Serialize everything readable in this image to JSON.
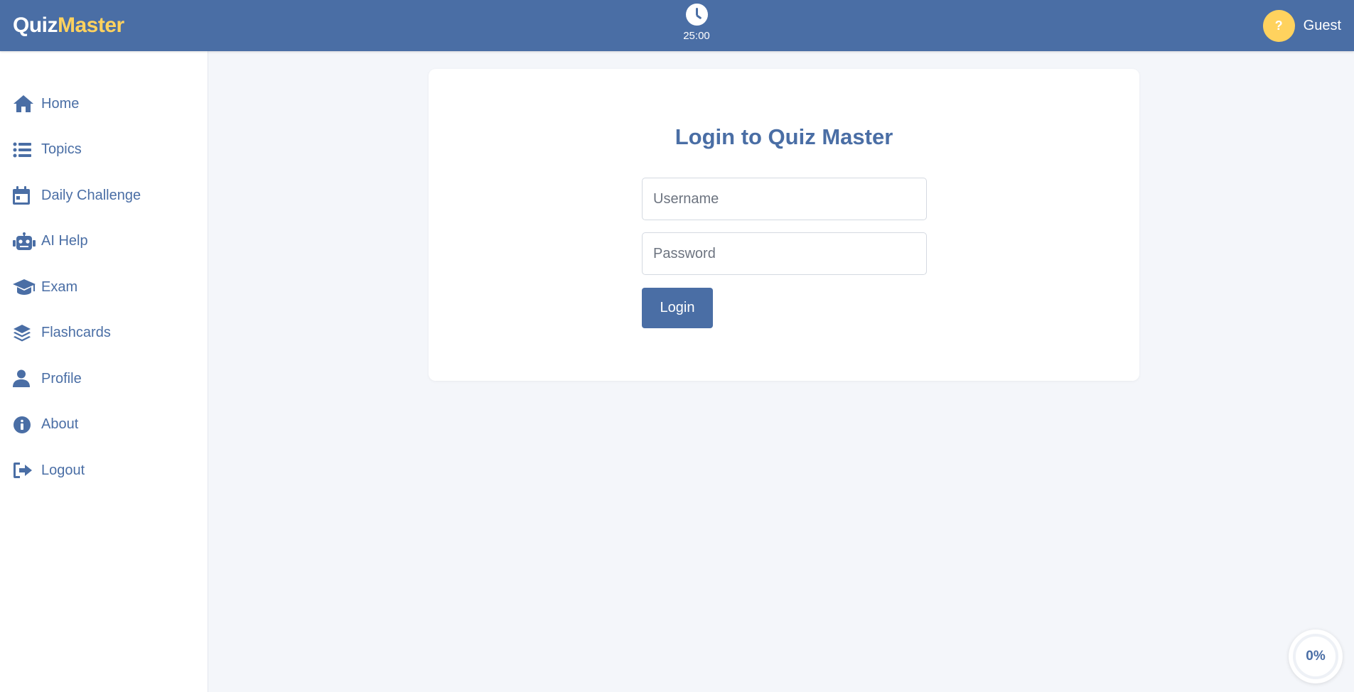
{
  "header": {
    "logo_part1": "Quiz",
    "logo_part2": "Master",
    "timer": "25:00",
    "avatar_char": "?",
    "username": "Guest"
  },
  "sidebar": {
    "items": [
      {
        "label": "Home",
        "icon": "home-icon"
      },
      {
        "label": "Topics",
        "icon": "list-icon"
      },
      {
        "label": "Daily Challenge",
        "icon": "calendar-icon"
      },
      {
        "label": "AI Help",
        "icon": "robot-icon"
      },
      {
        "label": "Exam",
        "icon": "graduation-cap-icon"
      },
      {
        "label": "Flashcards",
        "icon": "layers-icon"
      },
      {
        "label": "Profile",
        "icon": "user-icon"
      },
      {
        "label": "About",
        "icon": "info-icon"
      },
      {
        "label": "Logout",
        "icon": "logout-icon"
      }
    ]
  },
  "login": {
    "title": "Login to Quiz Master",
    "username_placeholder": "Username",
    "password_placeholder": "Password",
    "button_label": "Login"
  },
  "progress": {
    "label": "0%",
    "value": 0
  },
  "colors": {
    "primary": "#4a6ea5",
    "accent": "#ffd25e",
    "background": "#f4f6fa"
  }
}
